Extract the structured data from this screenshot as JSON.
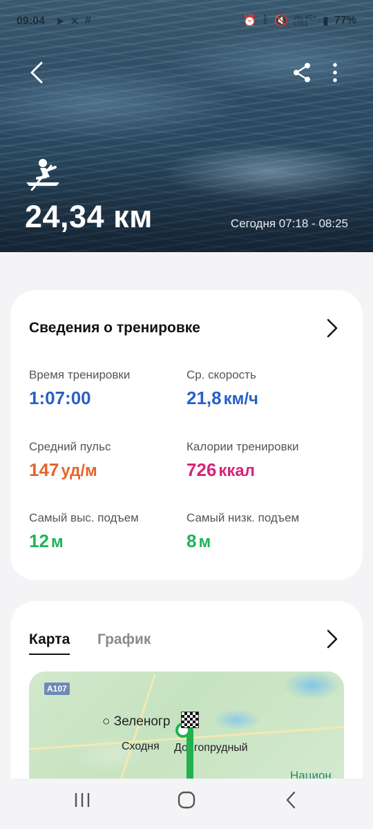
{
  "status_bar": {
    "time": "09:04",
    "left_icons": [
      "telegram-icon",
      "missed-call-icon",
      "grid-icon"
    ],
    "right_icons": [
      "alarm-icon",
      "bluetooth-icon",
      "mute-icon",
      "volte-icon",
      "signal-icon"
    ],
    "network": "Vo) 4G+ LTE1",
    "battery": "77%"
  },
  "header": {
    "distance": "24,34 км",
    "time_range": "Сегодня 07:18 - 08:25",
    "activity_icon": "rowing-icon"
  },
  "workout_card": {
    "title": "Сведения о тренировке",
    "stats": [
      {
        "label": "Время тренировки",
        "value": "1:07:00",
        "unit": "",
        "color": "#2760c9"
      },
      {
        "label": "Ср. скорость",
        "value": "21,8",
        "unit": "км/ч",
        "color": "#2760c9"
      },
      {
        "label": "Средний пульс",
        "value": "147",
        "unit": "уд/м",
        "color": "#e5652b"
      },
      {
        "label": "Калории тренировки",
        "value": "726",
        "unit": "ккал",
        "color": "#d8237a"
      },
      {
        "label": "Самый выс. подъем",
        "value": "12",
        "unit": "м",
        "color": "#1fb35a"
      },
      {
        "label": "Самый низк. подъем",
        "value": "8",
        "unit": "м",
        "color": "#1fb35a"
      }
    ]
  },
  "map_card": {
    "tabs": [
      {
        "label": "Карта",
        "active": true
      },
      {
        "label": "График",
        "active": false
      }
    ],
    "map_labels": {
      "road": "A107",
      "city1": "Зеленогр",
      "city2": "Сходня",
      "city3": "Долгопрудный",
      "park": "Национ"
    }
  }
}
